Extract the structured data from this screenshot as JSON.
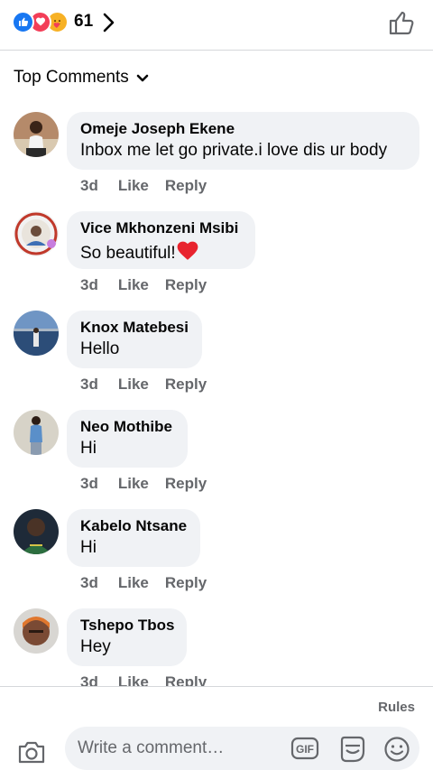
{
  "header": {
    "reaction_count": "61",
    "reaction_icons": [
      "like-reaction",
      "love-reaction",
      "care-reaction"
    ]
  },
  "sort": {
    "label": "Top Comments"
  },
  "comments": [
    {
      "name": "Omeje Joseph Ekene",
      "text": "Inbox me let go private.i love dis ur body",
      "time": "3d",
      "like": "Like",
      "reply": "Reply"
    },
    {
      "name": "Vice Mkhonzeni Msibi",
      "text": "So beautiful!",
      "time": "3d",
      "like": "Like",
      "reply": "Reply"
    },
    {
      "name": "Knox Matebesi",
      "text": "Hello",
      "time": "3d",
      "like": "Like",
      "reply": "Reply"
    },
    {
      "name": "Neo Mothibe",
      "text": "Hi",
      "time": "3d",
      "like": "Like",
      "reply": "Reply"
    },
    {
      "name": "Kabelo Ntsane",
      "text": "Hi",
      "time": "3d",
      "like": "Like",
      "reply": "Reply"
    },
    {
      "name": "Tshepo Tbos",
      "text": "Hey",
      "time": "3d",
      "like": "Like",
      "reply": "Reply"
    }
  ],
  "footer": {
    "rules": "Rules",
    "input_placeholder": "Write a comment…",
    "gif_label": "GIF"
  },
  "colors": {
    "like_blue": "#1877f2",
    "love_red": "#f33e58",
    "bubble_bg": "#f0f2f5",
    "secondary_text": "#65676b"
  }
}
